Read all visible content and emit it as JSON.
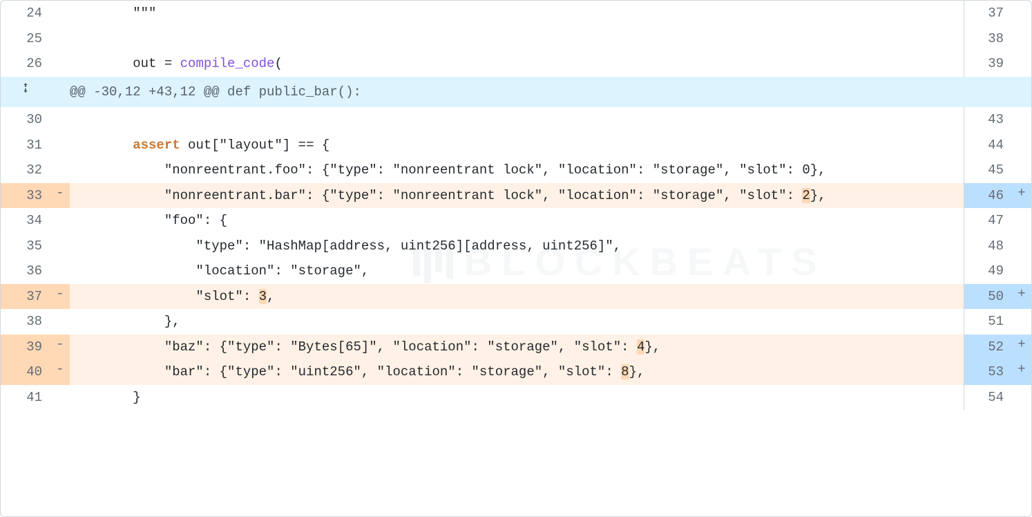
{
  "watermark_text": "BLOCKBEATS",
  "hunk_header": "@@ -30,12 +43,12 @@ def public_bar():",
  "rows": [
    {
      "type": "ctx",
      "ln_l": "24",
      "ln_r": "37",
      "code_html": "        <span class='hl-none'>\"\"\"</span>"
    },
    {
      "type": "ctx",
      "ln_l": "25",
      "ln_r": "38",
      "code_html": ""
    },
    {
      "type": "ctx",
      "ln_l": "26",
      "ln_r": "39",
      "code_html": "        out = <span class='fn-purple'>compile_code</span>("
    },
    {
      "type": "hunk"
    },
    {
      "type": "ctx",
      "ln_l": "30",
      "ln_r": "43",
      "code_html": ""
    },
    {
      "type": "ctx",
      "ln_l": "31",
      "ln_r": "44",
      "code_html": "        <span class='kw-orange'>assert</span> out[\"layout\"] == {"
    },
    {
      "type": "ctx",
      "ln_l": "32",
      "ln_r": "45",
      "code_html": "            \"nonreentrant.foo\": {\"type\": \"nonreentrant lock\", \"location\": \"storage\", \"slot\": 0},"
    },
    {
      "type": "diff",
      "ln_l": "33",
      "ln_r": "46",
      "code_html": "            \"nonreentrant.bar\": {\"type\": \"nonreentrant lock\", \"location\": \"storage\", \"slot\": <span class='hl-del'>2</span>},"
    },
    {
      "type": "ctx",
      "ln_l": "34",
      "ln_r": "47",
      "code_html": "            \"foo\": {",
      "add_btn": true
    },
    {
      "type": "ctx",
      "ln_l": "35",
      "ln_r": "48",
      "code_html": "                \"type\": \"HashMap[address, uint256][address, uint256]\","
    },
    {
      "type": "ctx",
      "ln_l": "36",
      "ln_r": "49",
      "code_html": "                \"location\": \"storage\","
    },
    {
      "type": "diff",
      "ln_l": "37",
      "ln_r": "50",
      "code_html": "                \"slot\": <span class='hl-del'>3</span>,"
    },
    {
      "type": "ctx",
      "ln_l": "38",
      "ln_r": "51",
      "code_html": "            },"
    },
    {
      "type": "diff",
      "ln_l": "39",
      "ln_r": "52",
      "code_html": "            \"baz\": {\"type\": \"Bytes[65]\", \"location\": \"storage\", \"slot\": <span class='hl-del'>4</span>},"
    },
    {
      "type": "diff",
      "ln_l": "40",
      "ln_r": "53",
      "code_html": "            \"bar\": {\"type\": \"uint256\", \"location\": \"storage\", \"slot\": <span class='hl-del'>8</span>},"
    },
    {
      "type": "ctx",
      "ln_l": "41",
      "ln_r": "54",
      "code_html": "        }"
    }
  ]
}
